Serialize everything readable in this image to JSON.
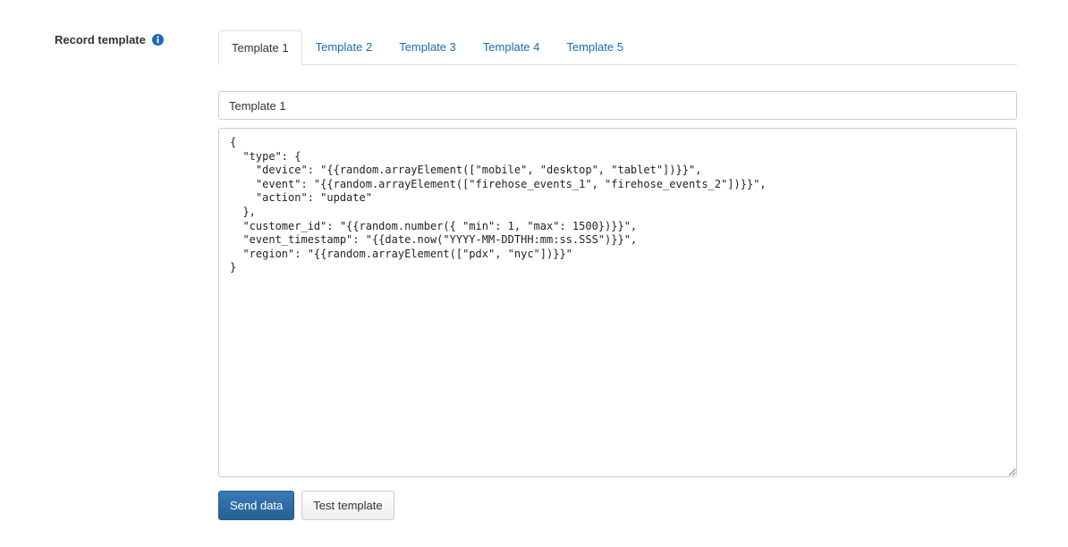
{
  "field": {
    "label": "Record template",
    "info_icon": "info-circle-icon"
  },
  "tabs": [
    {
      "label": "Template 1",
      "active": true
    },
    {
      "label": "Template 2",
      "active": false
    },
    {
      "label": "Template 3",
      "active": false
    },
    {
      "label": "Template 4",
      "active": false
    },
    {
      "label": "Template 5",
      "active": false
    }
  ],
  "template_name": {
    "value": "Template 1"
  },
  "template_body": {
    "value": "{\n  \"type\": {\n    \"device\": \"{{random.arrayElement([\"mobile\", \"desktop\", \"tablet\"])}}\",\n    \"event\": \"{{random.arrayElement([\"firehose_events_1\", \"firehose_events_2\"])}}\",\n    \"action\": \"update\"\n  },\n  \"customer_id\": \"{{random.number({ \"min\": 1, \"max\": 1500})}}\",\n  \"event_timestamp\": \"{{date.now(\"YYYY-MM-DDTHH:mm:ss.SSS\")}}\",\n  \"region\": \"{{random.arrayElement([\"pdx\", \"nyc\"])}}\"\n}"
  },
  "actions": {
    "send_label": "Send data",
    "test_label": "Test template"
  },
  "colors": {
    "link": "#1a6cb5",
    "primary_button": "#2e6da4",
    "info_icon": "#1a6cb5"
  }
}
